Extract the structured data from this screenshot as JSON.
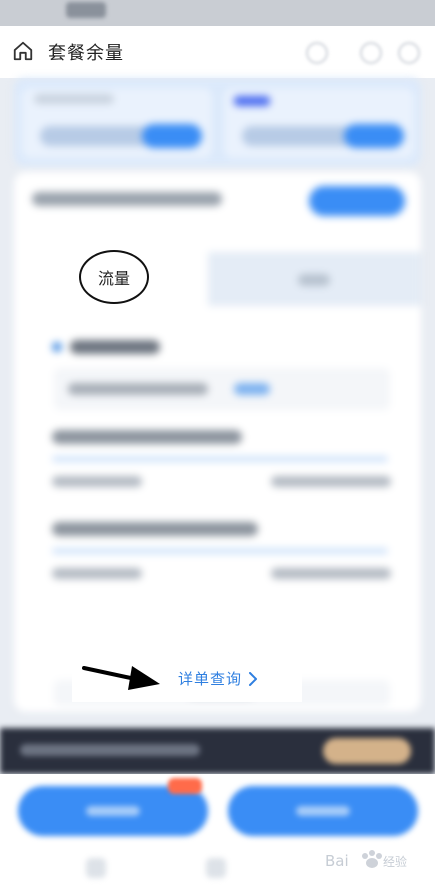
{
  "header": {
    "title": "套餐余量"
  },
  "flow_tab": {
    "label": "流量"
  },
  "detail_link": {
    "label": "详单查询"
  },
  "colors": {
    "accent": "#2f7fe0",
    "primary_button": "#3a8df5"
  },
  "icons": [
    "home-icon",
    "chevron-right-icon",
    "arrow-annotation-icon"
  ]
}
